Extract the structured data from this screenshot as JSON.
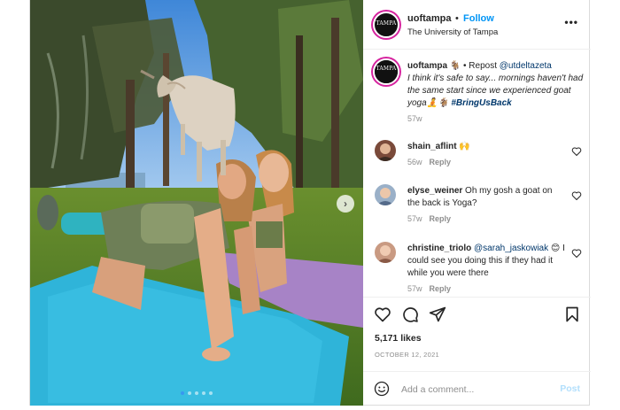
{
  "account": {
    "username": "uoftampa",
    "follow_label": "Follow",
    "separator": "•",
    "subtitle": "The University of Tampa",
    "avatar_text": "TAMPA"
  },
  "caption": {
    "username": "uoftampa",
    "username_suffix": "🐐",
    "repost_label": "• Repost",
    "repost_handle": "@utdeltazeta",
    "text": "I think it's safe to say... mornings haven't had the same start since we experienced goat yoga🧘🐐",
    "hashtag": "#BringUsBack",
    "time": "57w"
  },
  "comments": [
    {
      "username": "shain_aflint",
      "text": "🙌",
      "time": "56w",
      "reply_label": "Reply",
      "avatar_color": "#7a4a3a"
    },
    {
      "username": "elyse_weiner",
      "text": "Oh my gosh a goat on the back is Yoga?",
      "time": "57w",
      "reply_label": "Reply",
      "avatar_color": "#9ab0c8"
    },
    {
      "username": "christine_triolo",
      "mention": "@sarah_jaskowiak",
      "text": "😊 I could see you doing this if they had it while you were there",
      "time": "57w",
      "reply_label": "Reply",
      "avatar_color": "#c99a82"
    }
  ],
  "actions": {
    "like_icon": "heart-icon",
    "comment_icon": "comment-icon",
    "share_icon": "share-icon",
    "save_icon": "bookmark-icon"
  },
  "likes": "5,171 likes",
  "date": "OCTOBER 12, 2021",
  "add_comment": {
    "placeholder": "Add a comment...",
    "post_label": "Post",
    "emoji_icon": "emoji-icon"
  },
  "media": {
    "next_icon": "chevron-right-icon",
    "slide_count": 5,
    "active_slide": 1
  },
  "colors": {
    "link_blue": "#0095f6",
    "post_disabled": "#b2dffc",
    "muted": "#8e8e8e",
    "text": "#262626"
  }
}
